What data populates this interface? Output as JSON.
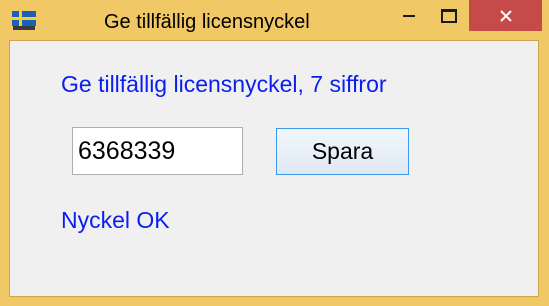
{
  "window": {
    "title": "Ge tillfällig licensnyckel",
    "icon": "swedish-flag-icon",
    "controls": [
      "minimize-icon",
      "maximize-icon",
      "close-icon"
    ]
  },
  "form": {
    "heading": "Ge tillfällig licensnyckel, 7 siffror",
    "key_value": "6368339",
    "save_label": "Spara",
    "status": "Nyckel OK"
  },
  "colors": {
    "accent_text": "#0a1ef0",
    "titlebar": "#f0c865",
    "close_button": "#c74a4a"
  }
}
